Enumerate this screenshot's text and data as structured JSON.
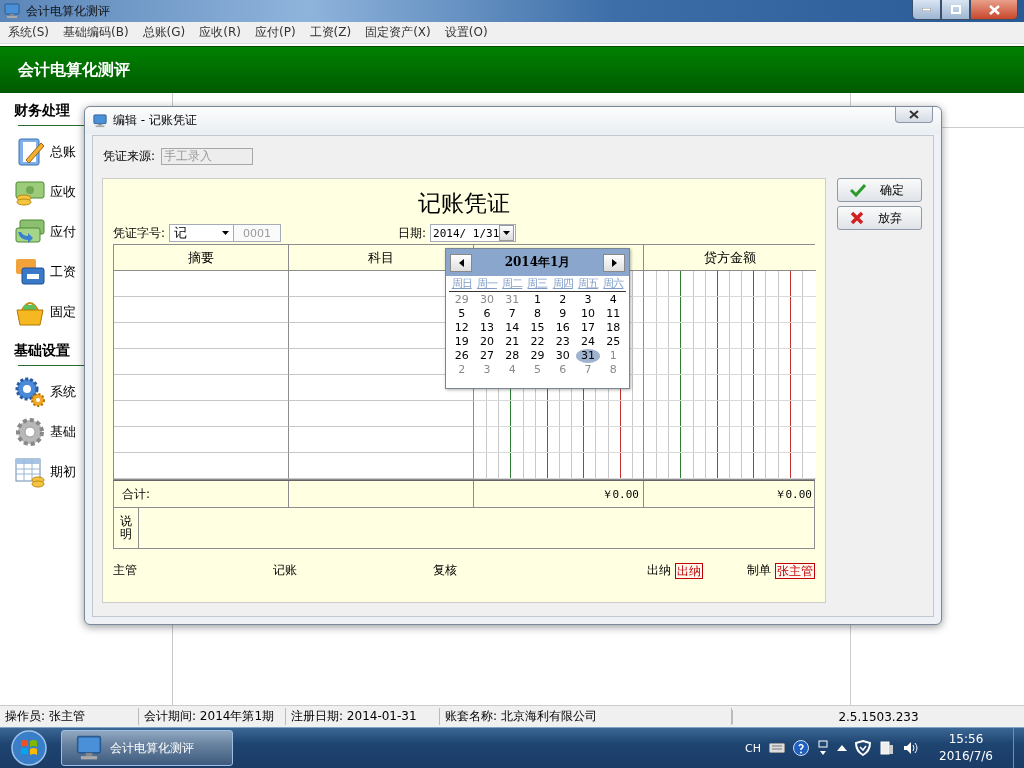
{
  "window": {
    "title": "会计电算化测评"
  },
  "menu": [
    "系统(S)",
    "基础编码(B)",
    "总账(G)",
    "应收(R)",
    "应付(P)",
    "工资(Z)",
    "固定资产(X)",
    "设置(O)"
  ],
  "header": {
    "title": "会计电算化测评"
  },
  "sidebar": [
    {
      "title": "财务处理",
      "items": [
        {
          "label": "总账",
          "kind": "notebook"
        },
        {
          "label": "应收",
          "kind": "cash-coins"
        },
        {
          "label": "应付",
          "kind": "cash-arrow"
        },
        {
          "label": "工资",
          "kind": "cards"
        },
        {
          "label": "固定",
          "kind": "basket"
        }
      ]
    },
    {
      "title": "基础设置",
      "items": [
        {
          "label": "系统",
          "kind": "gears"
        },
        {
          "label": "基础",
          "kind": "gear"
        },
        {
          "label": "期初",
          "kind": "table-coins"
        }
      ]
    }
  ],
  "dialog": {
    "title": "编辑 - 记账凭证",
    "source": {
      "label": "凭证来源:",
      "value": "手工录入"
    },
    "voucher": {
      "title": "记账凭证",
      "word": {
        "label": "凭证字号:",
        "value": "记",
        "number": "0001"
      },
      "date": {
        "label": "日期:",
        "value": "2014/ 1/31"
      },
      "columns": [
        {
          "label": "摘要",
          "kind": "text"
        },
        {
          "label": "科目",
          "kind": "text"
        },
        {
          "kind": "amount"
        },
        {
          "label": "贷方金额",
          "kind": "amount"
        }
      ],
      "totals": {
        "label": "合计:",
        "values": [
          "￥0.00",
          "￥0.00"
        ]
      },
      "note_label": "说明",
      "signatures": [
        {
          "label": "主管"
        },
        {
          "label": "记账"
        },
        {
          "label": "复核"
        },
        {
          "label": "出纳",
          "stamp": "出纳"
        },
        {
          "label": "制单",
          "stamp": "张主管"
        }
      ]
    },
    "buttons": [
      {
        "label": "确定",
        "kind": "ok"
      },
      {
        "label": "放弃",
        "kind": "cancel"
      }
    ],
    "calendar": {
      "title": "2014年1月",
      "weekdays": [
        "周日",
        "周一",
        "周二",
        "周三",
        "周四",
        "周五",
        "周六"
      ],
      "weeks": [
        [
          {
            "day": "29",
            "outside": true,
            "selected": false
          },
          {
            "day": "30",
            "outside": true,
            "selected": false
          },
          {
            "day": "31",
            "outside": true,
            "selected": false
          },
          {
            "day": "1",
            "outside": false,
            "selected": false
          },
          {
            "day": "2",
            "outside": false,
            "selected": false
          },
          {
            "day": "3",
            "outside": false,
            "selected": false
          },
          {
            "day": "4",
            "outside": false,
            "selected": false
          }
        ],
        [
          {
            "day": "5",
            "outside": false,
            "selected": false
          },
          {
            "day": "6",
            "outside": false,
            "selected": false
          },
          {
            "day": "7",
            "outside": false,
            "selected": false
          },
          {
            "day": "8",
            "outside": false,
            "selected": false
          },
          {
            "day": "9",
            "outside": false,
            "selected": false
          },
          {
            "day": "10",
            "outside": false,
            "selected": false
          },
          {
            "day": "11",
            "outside": false,
            "selected": false
          }
        ],
        [
          {
            "day": "12",
            "outside": false,
            "selected": false
          },
          {
            "day": "13",
            "outside": false,
            "selected": false
          },
          {
            "day": "14",
            "outside": false,
            "selected": false
          },
          {
            "day": "15",
            "outside": false,
            "selected": false
          },
          {
            "day": "16",
            "outside": false,
            "selected": false
          },
          {
            "day": "17",
            "outside": false,
            "selected": false
          },
          {
            "day": "18",
            "outside": false,
            "selected": false
          }
        ],
        [
          {
            "day": "19",
            "outside": false,
            "selected": false
          },
          {
            "day": "20",
            "outside": false,
            "selected": false
          },
          {
            "day": "21",
            "outside": false,
            "selected": false
          },
          {
            "day": "22",
            "outside": false,
            "selected": false
          },
          {
            "day": "23",
            "outside": false,
            "selected": false
          },
          {
            "day": "24",
            "outside": false,
            "selected": false
          },
          {
            "day": "25",
            "outside": false,
            "selected": false
          }
        ],
        [
          {
            "day": "26",
            "outside": false,
            "selected": false
          },
          {
            "day": "27",
            "outside": false,
            "selected": false
          },
          {
            "day": "28",
            "outside": false,
            "selected": false
          },
          {
            "day": "29",
            "outside": false,
            "selected": false
          },
          {
            "day": "30",
            "outside": false,
            "selected": false
          },
          {
            "day": "31",
            "outside": false,
            "selected": true
          },
          {
            "day": "1",
            "outside": true,
            "selected": false
          }
        ],
        [
          {
            "day": "2",
            "outside": true,
            "selected": false
          },
          {
            "day": "3",
            "outside": true,
            "selected": false
          },
          {
            "day": "4",
            "outside": true,
            "selected": false
          },
          {
            "day": "5",
            "outside": true,
            "selected": false
          },
          {
            "day": "6",
            "outside": true,
            "selected": false
          },
          {
            "day": "7",
            "outside": true,
            "selected": false
          },
          {
            "day": "8",
            "outside": true,
            "selected": false
          }
        ]
      ]
    }
  },
  "status_bar": [
    "操作员: 张主管",
    "会计期间: 2014年第1期",
    "注册日期: 2014-01-31",
    "账套名称: 北京海利有限公司",
    "2.5.1503.233"
  ],
  "taskbar": {
    "task": "会计电算化测评",
    "language": "CH",
    "time": "15:56",
    "date": "2016/7/6"
  }
}
